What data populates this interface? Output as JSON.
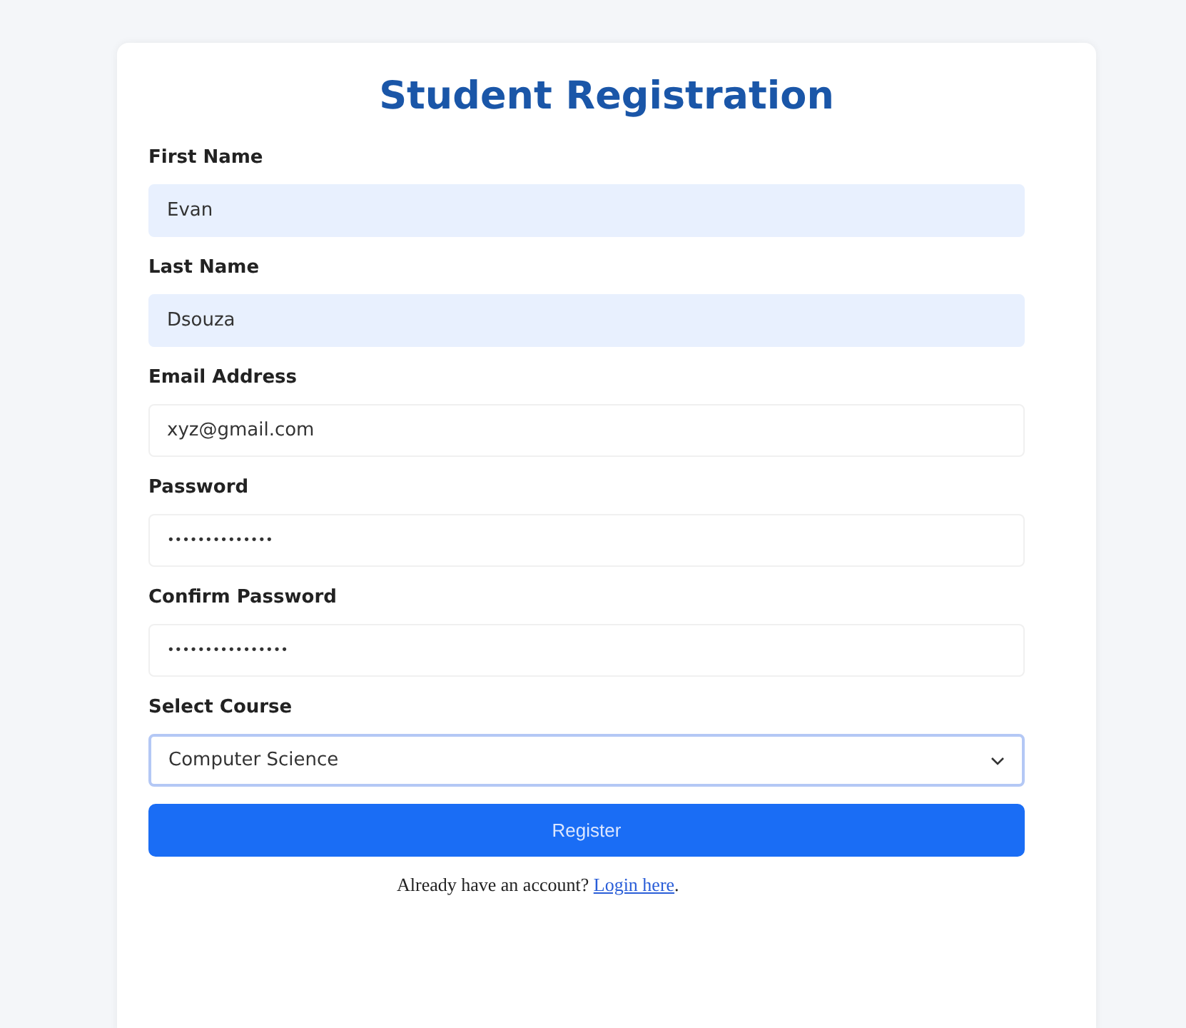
{
  "title": "Student Registration",
  "fields": [
    {
      "kind": "text",
      "label": "First Name",
      "value": "Evan",
      "autofilled": true,
      "focused": false
    },
    {
      "kind": "text",
      "label": "Last Name",
      "value": "Dsouza",
      "autofilled": true,
      "focused": false
    },
    {
      "kind": "text",
      "label": "Email Address",
      "value": "xyz@gmail.com",
      "autofilled": false,
      "focused": false
    },
    {
      "kind": "password",
      "label": "Password",
      "value": "••••••••••••••",
      "autofilled": false,
      "focused": false
    },
    {
      "kind": "password",
      "label": "Confirm Password",
      "value": "••••••••••••••••",
      "autofilled": false,
      "focused": false
    },
    {
      "kind": "select",
      "label": "Select Course",
      "value": "Computer Science",
      "autofilled": false,
      "focused": true
    }
  ],
  "button": "Register",
  "footer": {
    "text": "Already have an account?",
    "link": "Login here",
    "after": "."
  }
}
